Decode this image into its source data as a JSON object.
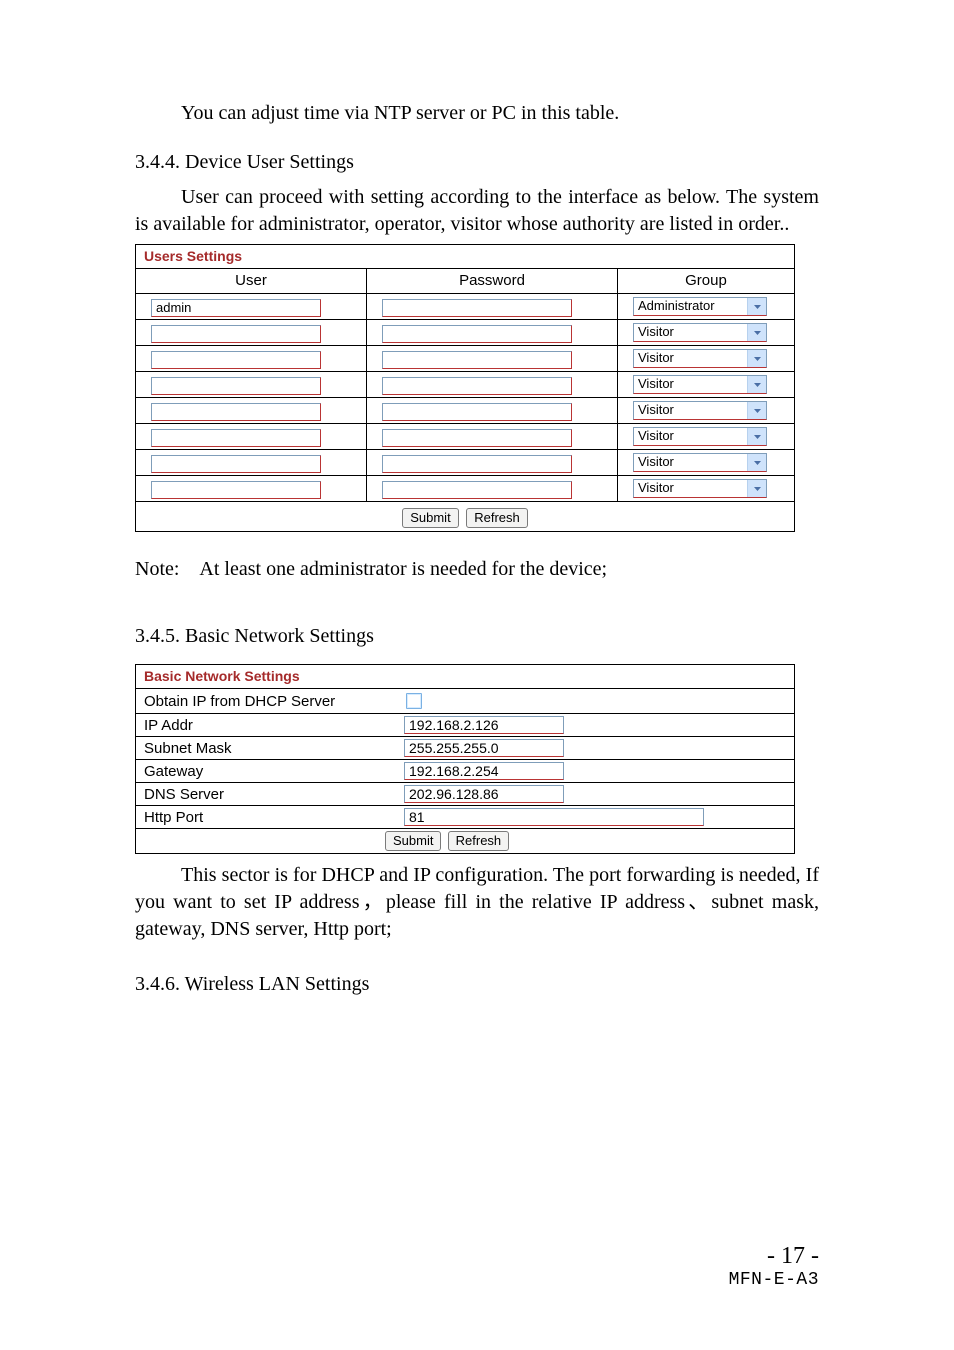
{
  "paragraphs": {
    "ntp": "You can adjust time via NTP server or PC in this table.",
    "section_344": "3.4.4. Device User Settings",
    "user_desc": "User can proceed with setting according to the interface as below. The system is available for administrator, operator, visitor whose authority are listed in order..",
    "note": "Note: At least one administrator is needed for the device;",
    "section_345": "3.4.5. Basic Network Settings",
    "dhcp_desc": "This sector is for DHCP and IP configuration. The port forwarding is needed, If you want to set IP address，please fill in the relative IP address、subnet mask, gateway, DNS server, Http port;",
    "section_346": "3.4.6. Wireless LAN Settings"
  },
  "users_settings": {
    "title": "Users Settings",
    "headers": {
      "user": "User",
      "password": "Password",
      "group": "Group"
    },
    "group_options": {
      "admin": "Administrator",
      "visitor": "Visitor"
    },
    "rows": [
      {
        "user": "admin",
        "password": "",
        "group": "Administrator"
      },
      {
        "user": "",
        "password": "",
        "group": "Visitor"
      },
      {
        "user": "",
        "password": "",
        "group": "Visitor"
      },
      {
        "user": "",
        "password": "",
        "group": "Visitor"
      },
      {
        "user": "",
        "password": "",
        "group": "Visitor"
      },
      {
        "user": "",
        "password": "",
        "group": "Visitor"
      },
      {
        "user": "",
        "password": "",
        "group": "Visitor"
      },
      {
        "user": "",
        "password": "",
        "group": "Visitor"
      }
    ],
    "buttons": {
      "submit": "Submit",
      "refresh": "Refresh"
    }
  },
  "network_settings": {
    "title": "Basic Network Settings",
    "rows": {
      "dhcp_label": "Obtain IP from DHCP Server",
      "dhcp_checked": false,
      "ip_label": "IP Addr",
      "ip_value": "192.168.2.126",
      "mask_label": "Subnet Mask",
      "mask_value": "255.255.255.0",
      "gw_label": "Gateway",
      "gw_value": "192.168.2.254",
      "dns_label": "DNS Server",
      "dns_value": "202.96.128.86",
      "http_label": "Http Port",
      "http_value": "81"
    },
    "buttons": {
      "submit": "Submit",
      "refresh": "Refresh"
    }
  },
  "footer": {
    "page": "- 17 -",
    "code": "MFN-E-A3"
  }
}
